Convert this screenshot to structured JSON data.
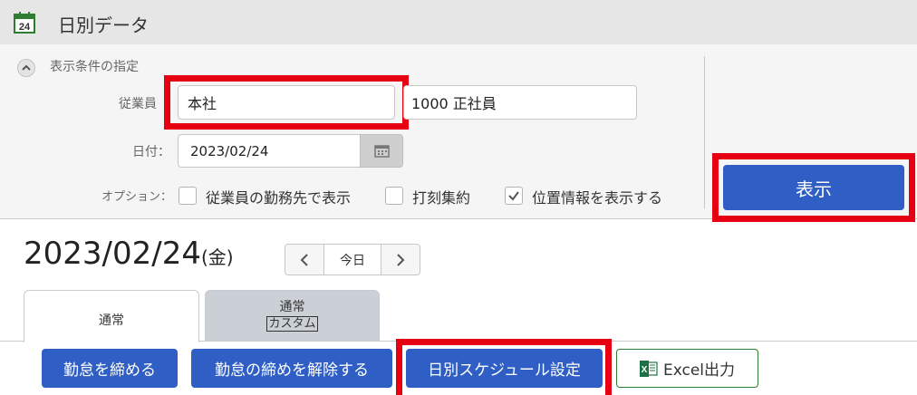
{
  "header": {
    "title": "日別データ",
    "icon": "calendar-24-icon",
    "icon_text": "24"
  },
  "conditions": {
    "title": "表示条件の指定",
    "employee_label": "従業員",
    "employee_group_value": "本社",
    "employee_value": "1000 正社員",
    "date_label": "日付：",
    "date_value": "2023/02/24",
    "options_label": "オプション：",
    "options": [
      {
        "label": "従業員の勤務先で表示",
        "checked": false
      },
      {
        "label": "打刻集約",
        "checked": false
      },
      {
        "label": "位置情報を表示する",
        "checked": true
      }
    ],
    "show_button": "表示"
  },
  "date_nav": {
    "date": "2023/02/24",
    "day_of_week": "(金)",
    "today_label": "今日"
  },
  "tabs": [
    {
      "label": "通常",
      "active": true
    },
    {
      "label": "通常",
      "sub": "カスタム",
      "active": false
    }
  ],
  "actions": {
    "close_attendance": "勤怠を締める",
    "release_attendance": "勤怠の締めを解除する",
    "daily_schedule": "日別スケジュール設定",
    "excel_export": "Excel出力"
  },
  "colors": {
    "primary": "#2f5ec4",
    "highlight": "#e60012",
    "excel_green": "#1e7145"
  }
}
